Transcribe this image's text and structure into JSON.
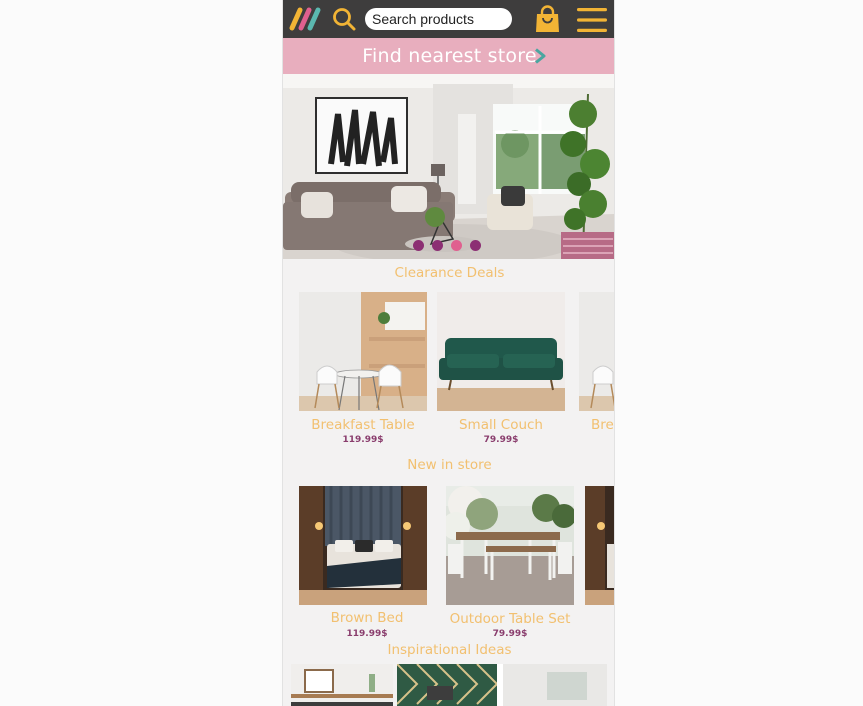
{
  "header": {
    "search_placeholder": "Search products",
    "logo_icon": "brand-stripes-logo",
    "search_icon": "magnifier-icon",
    "bag_icon": "shopping-bag-icon",
    "menu_icon": "hamburger-menu-icon"
  },
  "banner": {
    "label": "Find nearest store",
    "icon": "chevron-right-icon"
  },
  "hero": {
    "slide_count": 4,
    "active_slide": 3
  },
  "sections": {
    "clearance": {
      "title": "Clearance Deals",
      "items": [
        {
          "name": "Breakfast Table",
          "price": "119.99$"
        },
        {
          "name": "Small Couch",
          "price": "79.99$"
        },
        {
          "name": "Brea",
          "price": ""
        }
      ]
    },
    "new_in_store": {
      "title": "New in store",
      "items": [
        {
          "name": "Brown Bed",
          "price": "119.99$"
        },
        {
          "name": "Outdoor Table Set",
          "price": "79.99$"
        },
        {
          "name": "",
          "price": ""
        }
      ]
    },
    "inspirational": {
      "title": "Inspirational Ideas"
    }
  },
  "colors": {
    "topbar": "#3e3d3d",
    "accent_yellow": "#f2b435",
    "banner_pink": "#e8aebe",
    "title_gold": "#f2c070",
    "price_purple": "#8a3e6e",
    "dot_purple": "#8c2f73",
    "dot_pink": "#e0608f"
  }
}
